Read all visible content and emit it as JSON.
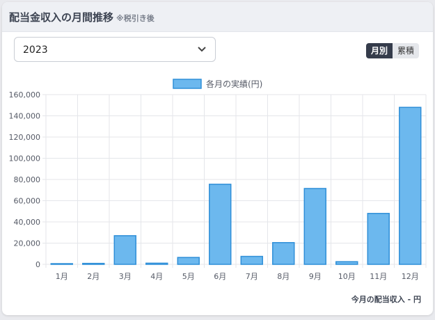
{
  "header": {
    "title": "配当金収入の月間推移",
    "note": "※税引き後"
  },
  "year_select": {
    "value": "2023"
  },
  "view_toggle": {
    "monthly": "月別",
    "cumulative": "累積"
  },
  "footer": {
    "label": "今月の配当収入",
    "value": "- 円"
  },
  "colors": {
    "bar_fill": "#6cb8ee",
    "bar_stroke": "#2f8fd8",
    "grid": "#e4e6ea",
    "text": "#555a66"
  },
  "chart_data": {
    "type": "bar",
    "categories": [
      "1月",
      "2月",
      "3月",
      "4月",
      "5月",
      "6月",
      "7月",
      "8月",
      "9月",
      "10月",
      "11月",
      "12月"
    ],
    "series": [
      {
        "name": "各月の実績(円)",
        "values": [
          500,
          900,
          27000,
          1100,
          6500,
          75500,
          7500,
          20500,
          71500,
          2500,
          48000,
          148000
        ]
      }
    ],
    "ylim": [
      0,
      160000
    ],
    "yticks": [
      "0",
      "20,000",
      "40,000",
      "60,000",
      "80,000",
      "100,000",
      "120,000",
      "140,000",
      "160,000"
    ],
    "legend": "top-center",
    "grid": true
  }
}
